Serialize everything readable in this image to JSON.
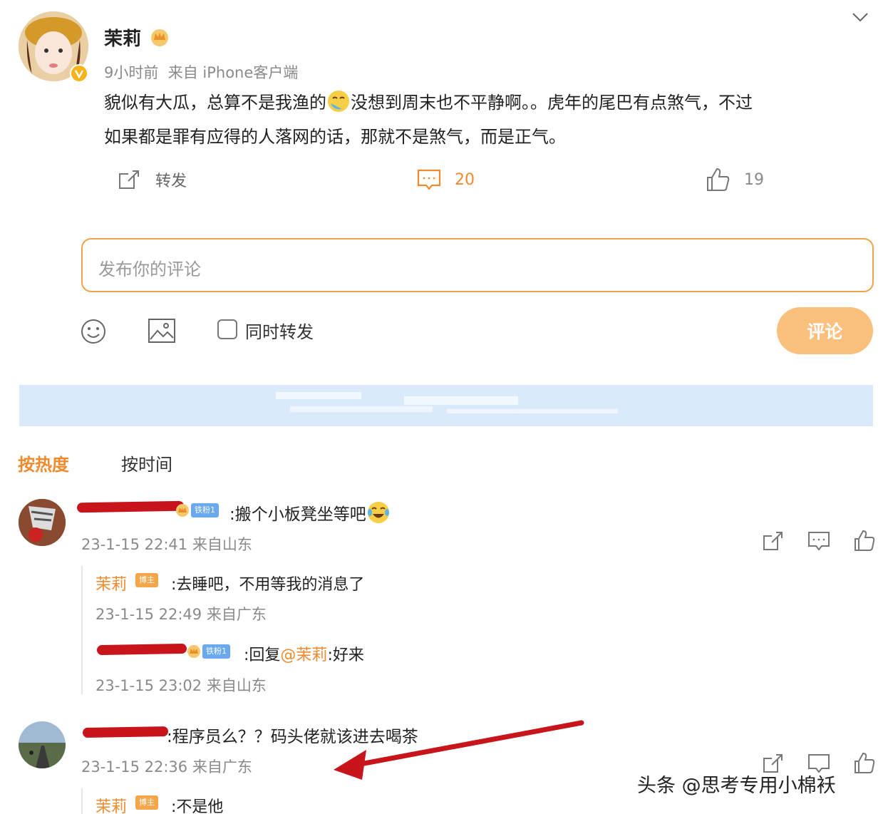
{
  "post": {
    "author_name": "茉莉",
    "meta": "9小时前  来自 iPhone客户端",
    "text_line1_a": "貌似有大瓜，总算不是我渔的",
    "text_line1_b": "没想到周末也不平静啊。。虎年的尾巴有点煞气，不过",
    "text_line2": "如果都是罪有应得的人落网的话，那就不是煞气，而是正气。",
    "repost_label": "转发",
    "comment_count": "20",
    "like_count": "19"
  },
  "composer": {
    "placeholder": "发布你的评论",
    "also_repost_label": "同时转发",
    "submit_label": "评论"
  },
  "sort_tabs": [
    {
      "label": "按热度",
      "active": true
    },
    {
      "label": "按时间",
      "active": false
    }
  ],
  "comments": [
    {
      "name": "",
      "fan_badge": "铁粉1",
      "text": ":搬个小板凳坐等吧",
      "meta": "23-1-15 22:41 来自山东",
      "replies": [
        {
          "name": "茉莉",
          "badge": "博主",
          "text": ":去睡吧，不用等我的消息了",
          "meta": "23-1-15 22:49 来自广东"
        },
        {
          "name": "",
          "fan_badge": "铁粉1",
          "text_prefix": ":回复",
          "mention": "@茉莉",
          "text_suffix": ":好来",
          "meta": "23-1-15 23:02 来自山东"
        }
      ]
    },
    {
      "name": "",
      "text": ":程序员么？？码头佬就该进去喝茶",
      "meta": "23-1-15 22:36 来自广东",
      "replies": [
        {
          "name": "茉莉",
          "badge": "博主",
          "text": ":不是他"
        }
      ]
    }
  ],
  "watermark": "头条 @思考专用小棉袄",
  "colors": {
    "accent": "#f08a2f",
    "button_bg": "#fbbf7e",
    "banner": "#dbeafa",
    "annotation_arrow": "#c8141b"
  }
}
